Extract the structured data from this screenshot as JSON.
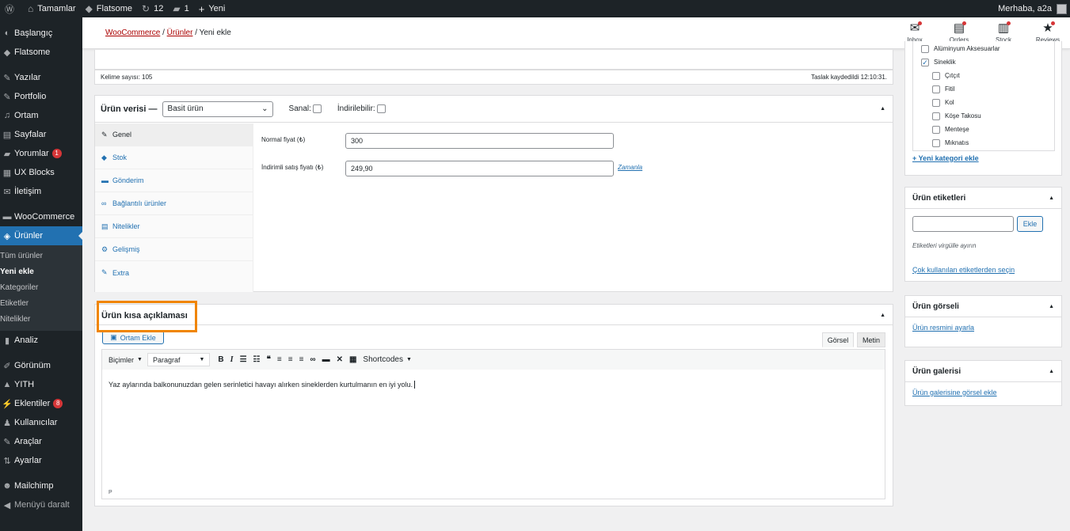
{
  "adminbar": {
    "wp_icon": "wordpress-icon",
    "site_label": "Tamamlar",
    "theme_label": "Flatsome",
    "updates_count": "12",
    "comments_count": "1",
    "new_label": "Yeni",
    "greeting": "Merhaba, a2a"
  },
  "sidebar": {
    "items": [
      {
        "label": "Başlangıç"
      },
      {
        "label": "Flatsome"
      },
      {
        "label": "Yazılar"
      },
      {
        "label": "Portfolio"
      },
      {
        "label": "Ortam"
      },
      {
        "label": "Sayfalar"
      },
      {
        "label": "Yorumlar",
        "badge": "1"
      },
      {
        "label": "UX Blocks"
      },
      {
        "label": "İletişim"
      },
      {
        "label": "WooCommerce"
      },
      {
        "label": "Ürünler"
      },
      {
        "label": "Analiz"
      },
      {
        "label": "Görünüm"
      },
      {
        "label": "YITH"
      },
      {
        "label": "Eklentiler",
        "badge": "8"
      },
      {
        "label": "Kullanıcılar"
      },
      {
        "label": "Araçlar"
      },
      {
        "label": "Ayarlar"
      },
      {
        "label": "Mailchimp"
      },
      {
        "label": "Menüyü daralt"
      }
    ],
    "submenu": [
      "Tüm ürünler",
      "Yeni ekle",
      "Kategoriler",
      "Etiketler",
      "Nitelikler"
    ]
  },
  "header": {
    "breadcrumb": {
      "woo": "WooCommerce",
      "products": "Ürünler",
      "sep": "/",
      "current": "Yeni ekle"
    },
    "icons": [
      {
        "label": "Inbox",
        "icon": "inbox-icon"
      },
      {
        "label": "Orders",
        "icon": "orders-icon"
      },
      {
        "label": "Stock",
        "icon": "stock-icon"
      },
      {
        "label": "Reviews",
        "icon": "reviews-icon"
      }
    ]
  },
  "editor_status": {
    "word_count": "Kelime sayısı: 105",
    "draft_saved": "Taslak kaydedildi 12:10:31."
  },
  "product_data": {
    "title": "Ürün verisi —",
    "type_selected": "Basit ürün",
    "virtual_label": "Sanal:",
    "downloadable_label": "İndirilebilir:",
    "tabs": [
      {
        "label": "Genel",
        "icon": "wrench-icon"
      },
      {
        "label": "Stok",
        "icon": "tag-icon"
      },
      {
        "label": "Gönderim",
        "icon": "truck-icon"
      },
      {
        "label": "Bağlantılı ürünler",
        "icon": "link-icon"
      },
      {
        "label": "Nitelikler",
        "icon": "list-icon"
      },
      {
        "label": "Gelişmiş",
        "icon": "gear-icon"
      },
      {
        "label": "Extra",
        "icon": "wrench-icon"
      }
    ],
    "regular_price_label": "Normal fiyat (₺)",
    "regular_price": "300",
    "sale_price_label": "İndirimli satış fiyatı (₺)",
    "sale_price": "249,90",
    "schedule_link": "Zamanla"
  },
  "short_description": {
    "title": "Ürün kısa açıklaması",
    "add_media": "Ortam Ekle",
    "tab_visual": "Görsel",
    "tab_text": "Metin",
    "formats": "Biçimler",
    "paragraph": "Paragraf",
    "shortcodes": "Shortcodes",
    "content": "Yaz aylarında balkonunuzdan gelen serinletici havayı alırken sineklerden kurtulmanın en iyi yolu.",
    "path": "P"
  },
  "categories": {
    "items": [
      {
        "label": "Alüminyum Aksesuarlar",
        "checked": false,
        "indent": 0
      },
      {
        "label": "Sineklik",
        "checked": true,
        "indent": 0
      },
      {
        "label": "Çıtçıt",
        "checked": false,
        "indent": 1
      },
      {
        "label": "Fitil",
        "checked": false,
        "indent": 1
      },
      {
        "label": "Kol",
        "checked": false,
        "indent": 1
      },
      {
        "label": "Köşe Takosu",
        "checked": false,
        "indent": 1
      },
      {
        "label": "Menteşe",
        "checked": false,
        "indent": 1
      },
      {
        "label": "Mıknatıs",
        "checked": false,
        "indent": 1
      }
    ],
    "add_new": "+ Yeni kategori ekle"
  },
  "tags": {
    "title": "Ürün etiketleri",
    "add_button": "Ekle",
    "hint": "Etiketleri virgülle ayırın",
    "popular_link": "Çok kullanılan etiketlerden seçin"
  },
  "product_image": {
    "title": "Ürün görseli",
    "link": "Ürün resmini ayarla"
  },
  "gallery": {
    "title": "Ürün galerisi",
    "link": "Ürün galerisine görsel ekle"
  },
  "colors": {
    "accent": "#2271b1",
    "highlight": "#f08500",
    "admin_dark": "#1d2327",
    "badge": "#d63638"
  }
}
